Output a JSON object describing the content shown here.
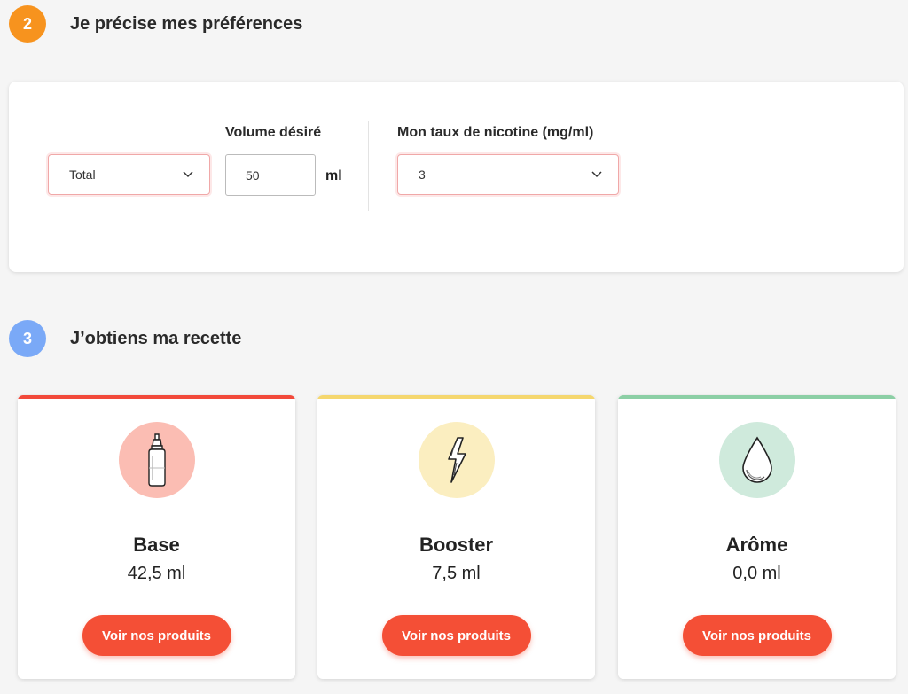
{
  "step2": {
    "number": "2",
    "title": "Je précise mes préférences",
    "badge_color": "#f7931e"
  },
  "preferences": {
    "mode_select": {
      "value": "Total"
    },
    "volume": {
      "label": "Volume désiré",
      "value": "50",
      "unit": "ml"
    },
    "nicotine": {
      "label": "Mon taux de nicotine (mg/ml)",
      "value": "3"
    }
  },
  "step3": {
    "number": "3",
    "title": "J’obtiens ma recette",
    "badge_color": "#7aa9f7"
  },
  "recipe": [
    {
      "title": "Base",
      "value": "42,5 ml",
      "button": "Voir nos produits",
      "accent": "#f2493a",
      "circle": "#fbbdb3",
      "icon": "bottle-icon"
    },
    {
      "title": "Booster",
      "value": "7,5 ml",
      "button": "Voir nos produits",
      "accent": "#f5d76e",
      "circle": "#fbeec0",
      "icon": "lightning-icon"
    },
    {
      "title": "Arôme",
      "value": "0,0 ml",
      "button": "Voir nos produits",
      "accent": "#8ccfa5",
      "circle": "#cfeadc",
      "icon": "drop-icon"
    }
  ]
}
